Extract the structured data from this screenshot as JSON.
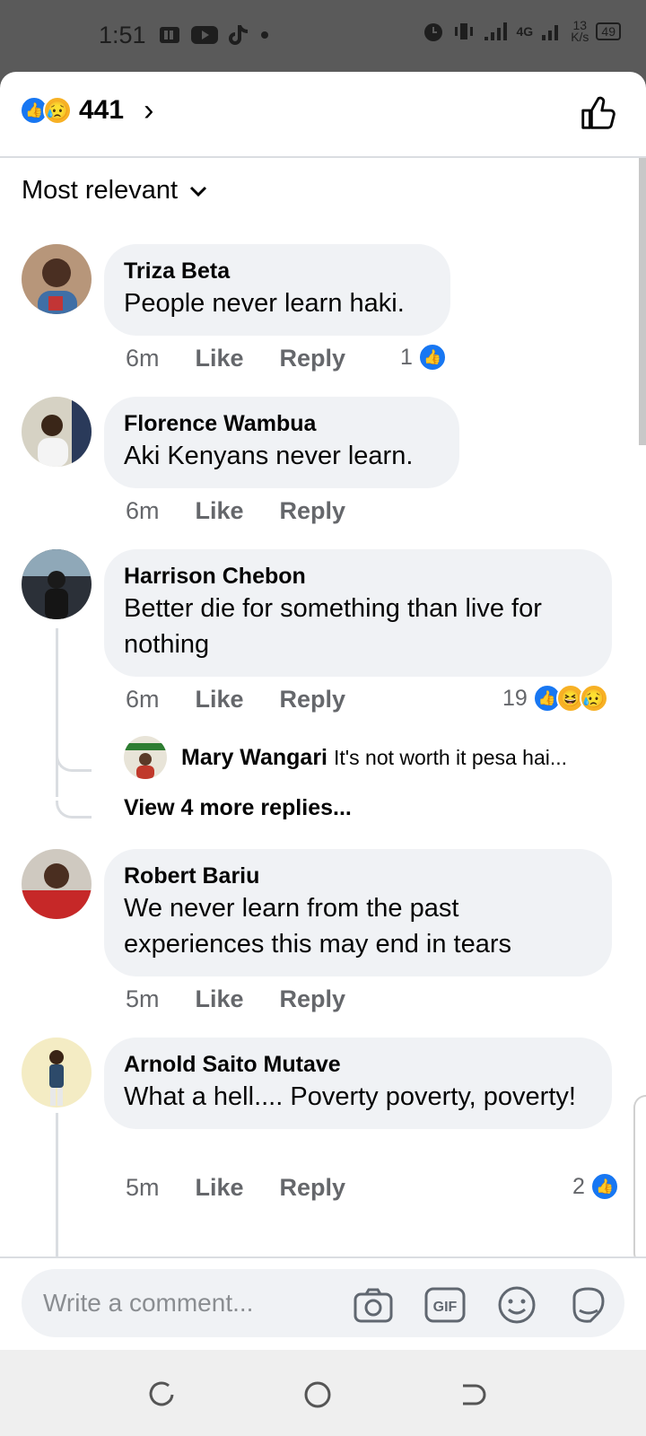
{
  "status_bar": {
    "time": "1:51",
    "network": "4G",
    "speed_value": "13",
    "speed_unit": "K/s",
    "battery": "49"
  },
  "header": {
    "reaction_count": "441",
    "reaction_icons": [
      "like-icon",
      "sad-icon"
    ]
  },
  "sort": {
    "label": "Most relevant"
  },
  "comments": [
    {
      "author": "Triza Beta",
      "text": "People never learn haki.",
      "time": "6m",
      "like": "Like",
      "reply": "Reply",
      "reaction_count": "1",
      "reactions": [
        "like"
      ]
    },
    {
      "author": "Florence Wambua",
      "text": "Aki Kenyans never learn.",
      "time": "6m",
      "like": "Like",
      "reply": "Reply"
    },
    {
      "author": "Harrison Chebon",
      "text": "Better die for something than live for nothing",
      "time": "6m",
      "like": "Like",
      "reply": "Reply",
      "reaction_count": "19",
      "reactions": [
        "like",
        "haha",
        "sad"
      ],
      "reply_preview": {
        "author": "Mary Wangari",
        "text": "It's not worth it pesa hai..."
      },
      "view_more": "View 4 more replies..."
    },
    {
      "author": "Robert Bariu",
      "text": "We never learn from the past experiences this may end in tears",
      "time": "5m",
      "like": "Like",
      "reply": "Reply"
    },
    {
      "author": "Arnold Saito Mutave",
      "text": "What a hell.... Poverty poverty, poverty!",
      "time": "5m",
      "like": "Like",
      "reply": "Reply",
      "reaction_count": "2",
      "reactions": [
        "like"
      ]
    }
  ],
  "composer": {
    "placeholder": "Write a comment..."
  },
  "colors": {
    "accent": "#1877f2",
    "bubble": "#f0f2f5",
    "secondary_text": "#65676b"
  }
}
